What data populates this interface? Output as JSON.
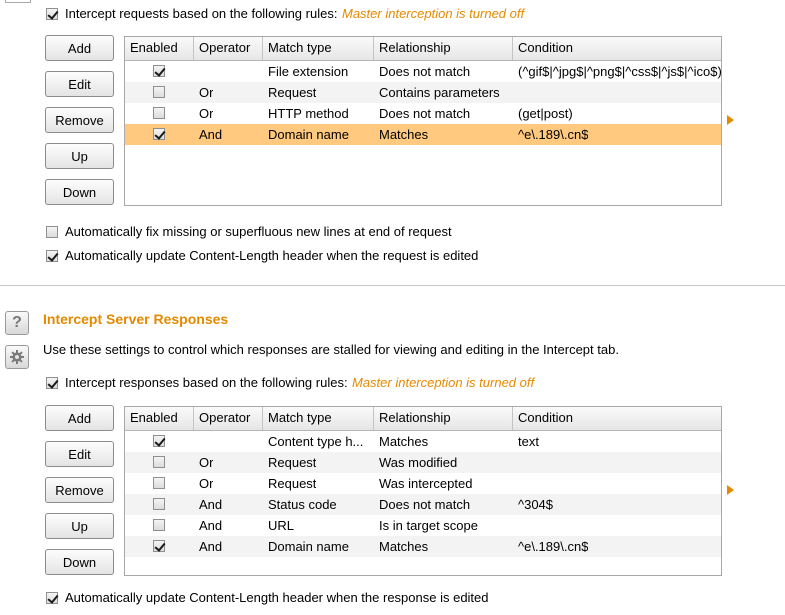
{
  "requests": {
    "intercept_label": "Intercept requests based on the following rules:",
    "master_note": "Master interception is turned off",
    "buttons": [
      "Add",
      "Edit",
      "Remove",
      "Up",
      "Down"
    ],
    "columns": [
      "Enabled",
      "Operator",
      "Match type",
      "Relationship",
      "Condition"
    ],
    "rows": [
      {
        "enabled": true,
        "operator": "",
        "match_type": "File extension",
        "relationship": "Does not match",
        "condition": "(^gif$|^jpg$|^png$|^css$|^js$|^ico$)"
      },
      {
        "enabled": false,
        "operator": "Or",
        "match_type": "Request",
        "relationship": "Contains parameters",
        "condition": ""
      },
      {
        "enabled": false,
        "operator": "Or",
        "match_type": "HTTP method",
        "relationship": "Does not match",
        "condition": "(get|post)"
      },
      {
        "enabled": true,
        "operator": "And",
        "match_type": "Domain name",
        "relationship": "Matches",
        "condition": "^e\\.189\\.cn$"
      }
    ],
    "fix_newlines_label": "Automatically fix missing or superfluous new lines at end of request",
    "update_length_label": "Automatically update Content-Length header when the request is edited"
  },
  "responses": {
    "section_title": "Intercept Server Responses",
    "description": "Use these settings to control which responses are stalled for viewing and editing in the Intercept tab.",
    "intercept_label": "Intercept responses based on the following rules:",
    "master_note": "Master interception is turned off",
    "buttons": [
      "Add",
      "Edit",
      "Remove",
      "Up",
      "Down"
    ],
    "columns": [
      "Enabled",
      "Operator",
      "Match type",
      "Relationship",
      "Condition"
    ],
    "rows": [
      {
        "enabled": true,
        "operator": "",
        "match_type": "Content type h...",
        "relationship": "Matches",
        "condition": "text"
      },
      {
        "enabled": false,
        "operator": "Or",
        "match_type": "Request",
        "relationship": "Was modified",
        "condition": ""
      },
      {
        "enabled": false,
        "operator": "Or",
        "match_type": "Request",
        "relationship": "Was intercepted",
        "condition": ""
      },
      {
        "enabled": false,
        "operator": "And",
        "match_type": "Status code",
        "relationship": "Does not match",
        "condition": "^304$"
      },
      {
        "enabled": false,
        "operator": "And",
        "match_type": "URL",
        "relationship": "Is in target scope",
        "condition": ""
      },
      {
        "enabled": true,
        "operator": "And",
        "match_type": "Domain name",
        "relationship": "Matches",
        "condition": "^e\\.189\\.cn$"
      }
    ],
    "update_length_label": "Automatically update Content-Length header when the response is edited"
  },
  "colors": {
    "accent": "#e58a00",
    "selected_row": "#ffc97f"
  },
  "icons": [
    "help-icon",
    "settings-gear-icon",
    "expand-arrow-icon"
  ]
}
